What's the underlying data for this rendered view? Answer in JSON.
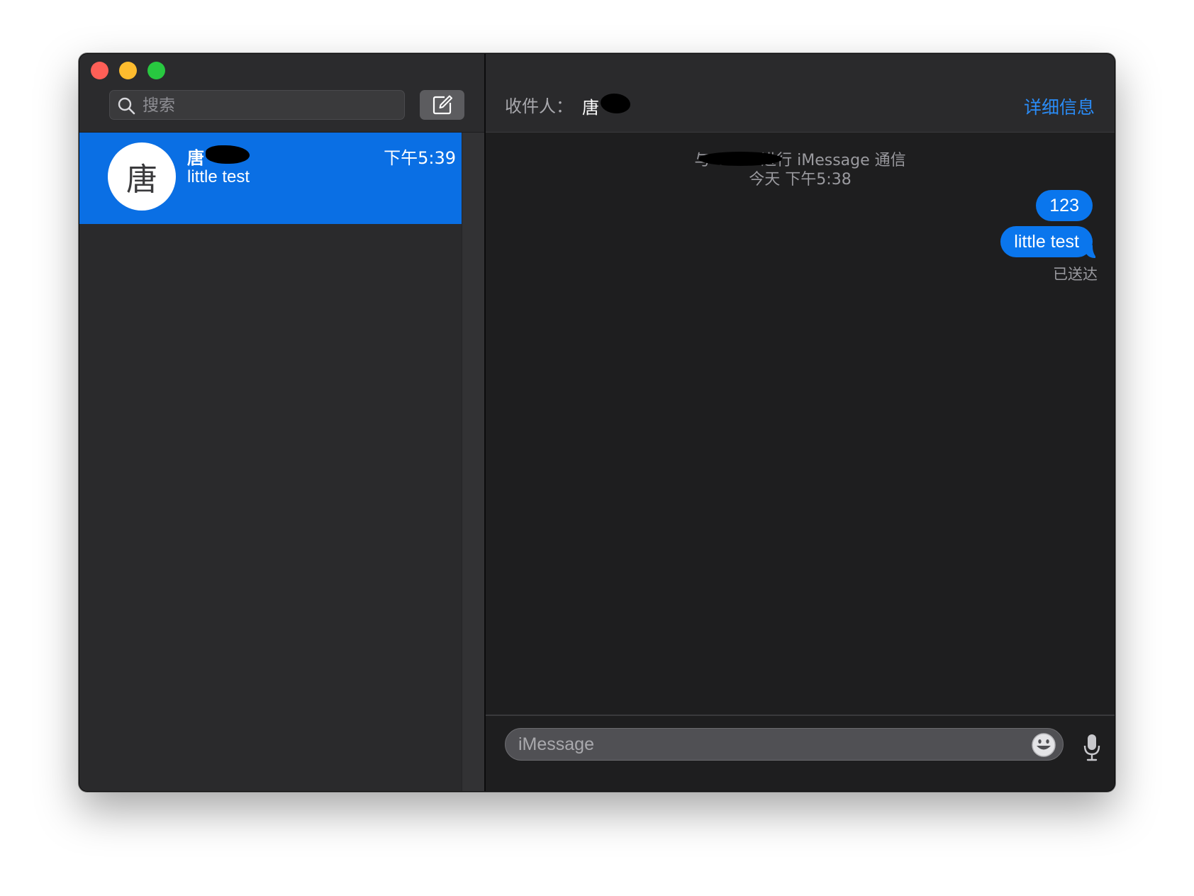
{
  "sidebar": {
    "search": {
      "placeholder": "搜索"
    },
    "conversations": [
      {
        "avatar_initial": "唐",
        "name": "唐",
        "time": "下午5:39",
        "preview": "little test"
      }
    ]
  },
  "chat": {
    "header": {
      "to_label": "收件人：",
      "recipient": "唐",
      "details_label": "详细信息"
    },
    "system_info": {
      "line1": "与“181               ”进行 iMessage 通信",
      "line2": "今天 下午5:38"
    },
    "messages": [
      {
        "text": "123",
        "direction": "outgoing"
      },
      {
        "text": "little test",
        "direction": "outgoing"
      }
    ],
    "status": "已送达",
    "composer": {
      "placeholder": "iMessage"
    }
  },
  "colors": {
    "accent": "#0a76ed",
    "selection": "#0a6fe4",
    "link": "#2a8cf7",
    "close": "#fe5f57",
    "minimize": "#febc2e",
    "zoom": "#28c840"
  },
  "icons": [
    "search-icon",
    "compose-icon",
    "emoji-icon",
    "microphone-icon"
  ]
}
